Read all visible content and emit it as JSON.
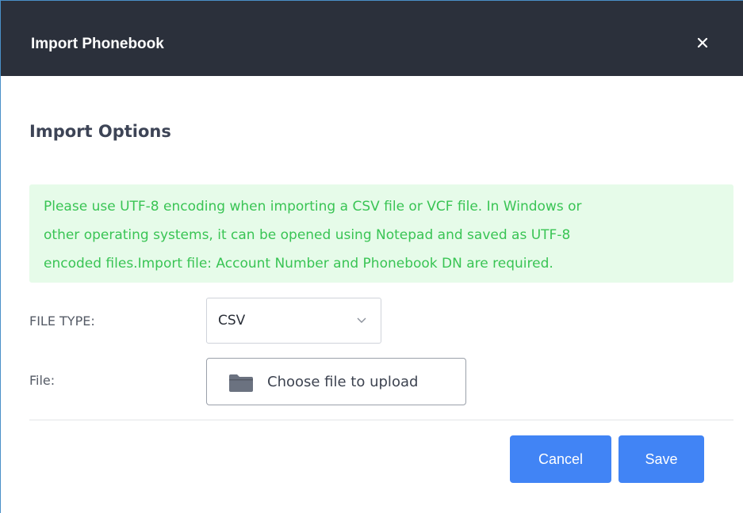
{
  "dialog": {
    "title": "Import Phonebook",
    "close_icon": "close-icon"
  },
  "section": {
    "title": "Import Options"
  },
  "notice": {
    "lines": [
      "Please use UTF-8 encoding when importing a CSV file or VCF file. In Windows or",
      "other operating systems, it can be opened using Notepad and saved as UTF-8",
      "encoded files.Import file: Account Number and Phonebook DN are required."
    ]
  },
  "form": {
    "file_type_label": "FILE TYPE:",
    "file_type_value": "CSV",
    "file_label": "File:",
    "upload_label": "Choose file to upload",
    "upload_icon": "folder-icon"
  },
  "actions": {
    "cancel_label": "Cancel",
    "save_label": "Save"
  },
  "colors": {
    "header_bg": "#2b303b",
    "notice_bg": "#e6fbe9",
    "notice_text": "#39c454",
    "primary_button": "#4184f5"
  }
}
